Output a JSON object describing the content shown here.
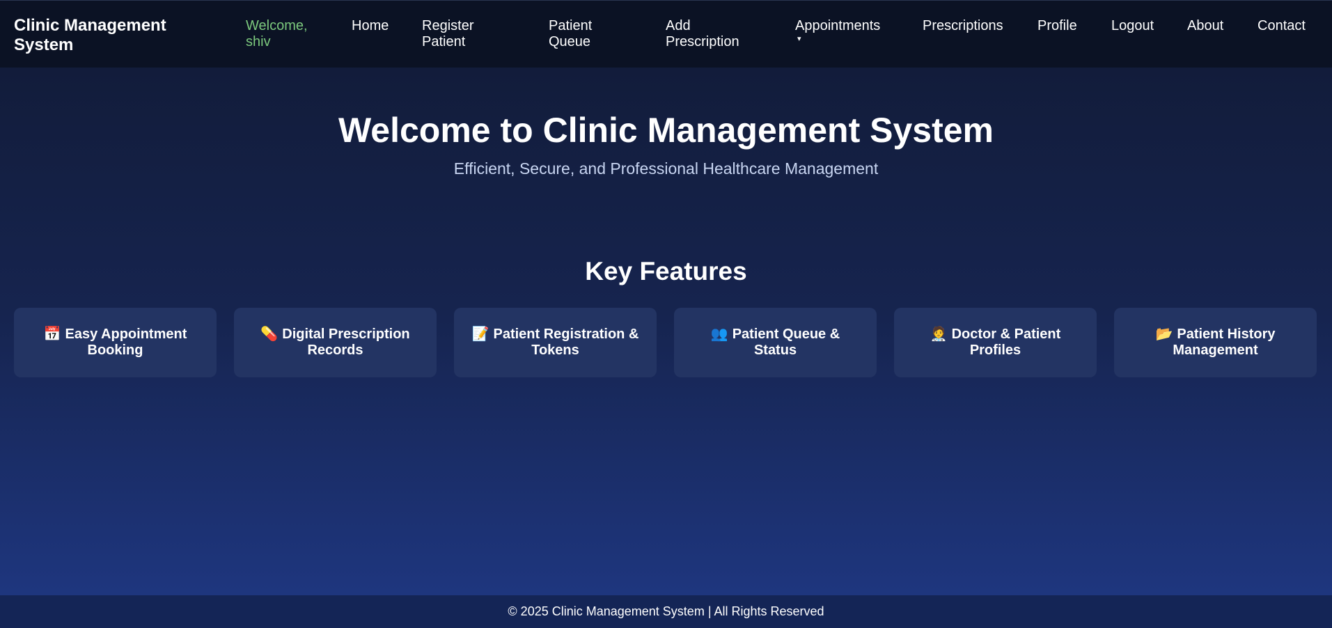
{
  "brand": "Clinic Management System",
  "nav": {
    "welcome": "Welcome, shiv",
    "home": "Home",
    "register_patient": "Register Patient",
    "patient_queue": "Patient Queue",
    "add_prescription": "Add Prescription",
    "appointments": "Appointments",
    "appointments_caret": "▾",
    "prescriptions": "Prescriptions",
    "profile": "Profile",
    "logout": "Logout",
    "about": "About",
    "contact": "Contact"
  },
  "hero": {
    "title": "Welcome to Clinic Management System",
    "subtitle": "Efficient, Secure, and Professional Healthcare Management"
  },
  "features": {
    "heading": "Key Features",
    "items": [
      {
        "icon": "calendar-icon",
        "glyph": "📅",
        "label": "Easy Appointment Booking"
      },
      {
        "icon": "pill-icon",
        "glyph": "💊",
        "label": "Digital Prescription Records"
      },
      {
        "icon": "memo-icon",
        "glyph": "📝",
        "label": "Patient Registration & Tokens"
      },
      {
        "icon": "people-icon",
        "glyph": "👥",
        "label": "Patient Queue & Status"
      },
      {
        "icon": "doctor-icon",
        "glyph": "🧑‍⚕️",
        "label": "Doctor & Patient Profiles"
      },
      {
        "icon": "folder-icon",
        "glyph": "📂",
        "label": "Patient History Management"
      }
    ]
  },
  "footer": "© 2025 Clinic Management System | All Rights Reserved",
  "colors": {
    "navbar_bg": "#0b1224",
    "welcome_text": "#7cc97d",
    "card_bg": "#233463",
    "footer_bg": "#142556"
  }
}
